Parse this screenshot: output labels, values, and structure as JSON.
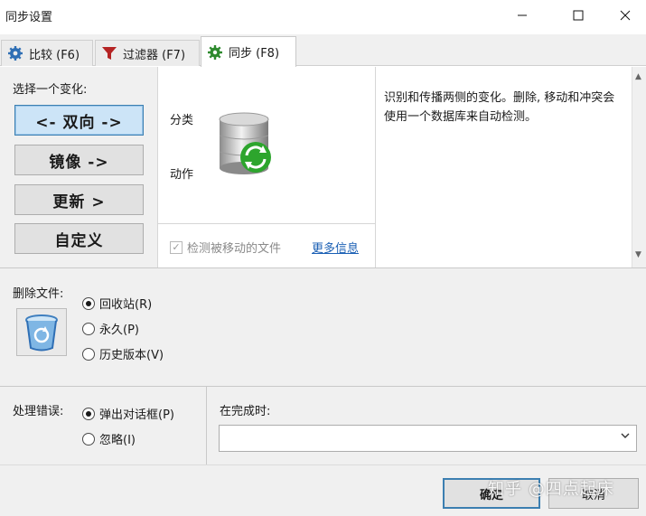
{
  "window": {
    "title": "同步设置",
    "min_icon": "minimize-icon",
    "max_icon": "maximize-icon",
    "close_icon": "close-icon"
  },
  "tabs": [
    {
      "label": "比较 (F6)",
      "icon": "gear-icon",
      "active": false
    },
    {
      "label": "过滤器 (F7)",
      "icon": "filter-icon",
      "active": false
    },
    {
      "label": "同步 (F8)",
      "icon": "gear-icon",
      "active": true
    }
  ],
  "variant": {
    "label": "选择一个变化:",
    "options": [
      {
        "label": "<- 双向 ->",
        "selected": true
      },
      {
        "label": "镜像 ->",
        "selected": false
      },
      {
        "label": "更新 >",
        "selected": false
      },
      {
        "label": "自定义",
        "selected": false
      }
    ]
  },
  "middle": {
    "category_label": "分类",
    "action_label": "动作",
    "db_icon": "database-sync-icon",
    "detect_moved_label": "检测被移动的文件",
    "detect_moved_checked": true,
    "more_info_link": "更多信息"
  },
  "description": "识别和传播两侧的变化。删除, 移动和冲突会使用一个数据库来自动检测。",
  "delete": {
    "label": "删除文件:",
    "icon": "recycle-bin-icon",
    "options": [
      {
        "label": "回收站(R)",
        "selected": true
      },
      {
        "label": "永久(P)",
        "selected": false
      },
      {
        "label": "历史版本(V)",
        "selected": false
      }
    ]
  },
  "errors": {
    "label": "处理错误:",
    "options": [
      {
        "label": "弹出对话框(P)",
        "selected": true
      },
      {
        "label": "忽略(I)",
        "selected": false
      }
    ]
  },
  "on_completion": {
    "label": "在完成时:",
    "value": ""
  },
  "buttons": {
    "ok": "确定",
    "cancel": "取消"
  },
  "watermark": "知乎 @四点起床",
  "colors": {
    "accent": "#3c7fb1",
    "selected_bg": "#cce4f7",
    "link": "#1a5fb4",
    "panel_bg": "#f0f0f0"
  }
}
